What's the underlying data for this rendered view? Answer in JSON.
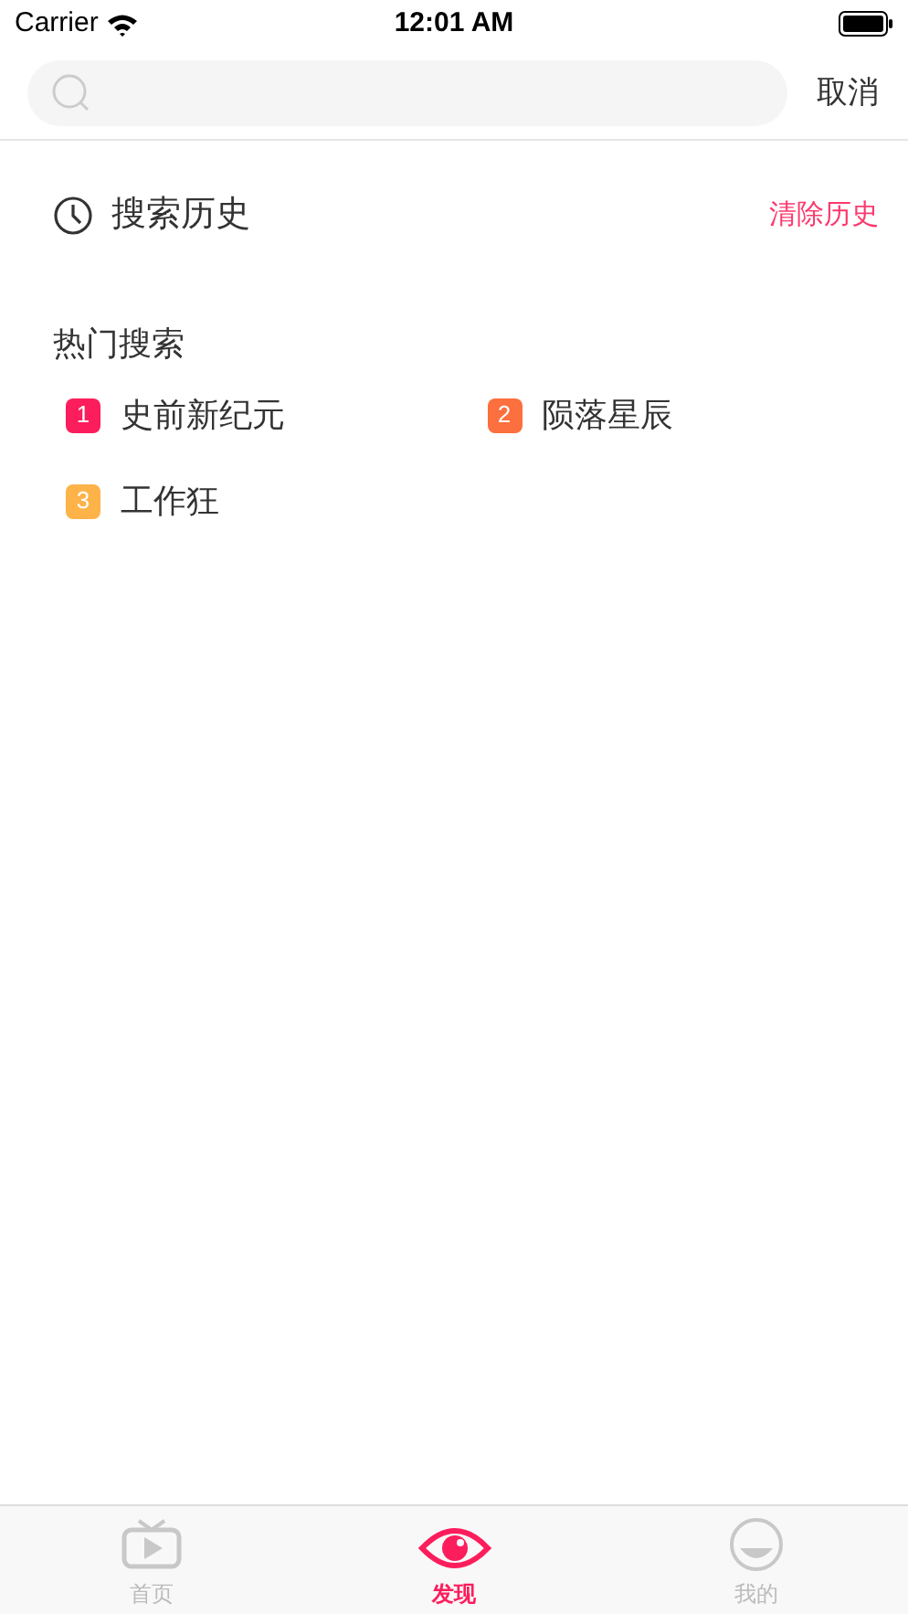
{
  "status_bar": {
    "carrier": "Carrier",
    "time": "12:01 AM"
  },
  "search": {
    "cancel": "取消"
  },
  "history": {
    "title": "搜索历史",
    "clear": "清除历史"
  },
  "hot": {
    "title": "热门搜索",
    "items": [
      {
        "rank": "1",
        "label": "史前新纪元",
        "color": "#fc1d5c"
      },
      {
        "rank": "2",
        "label": "陨落星辰",
        "color": "#fc6f3e"
      },
      {
        "rank": "3",
        "label": "工作狂",
        "color": "#fdb348"
      }
    ]
  },
  "tabs": [
    {
      "kind": "tv",
      "label": "首页",
      "selected": false
    },
    {
      "kind": "eye",
      "label": "发现",
      "selected": true
    },
    {
      "kind": "face",
      "label": "我的",
      "selected": false
    }
  ]
}
